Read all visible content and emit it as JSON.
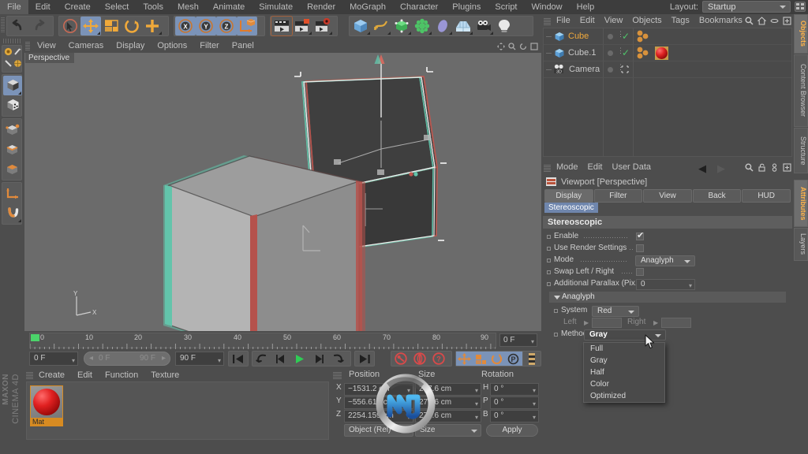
{
  "menubar": {
    "items": [
      "File",
      "Edit",
      "Create",
      "Select",
      "Tools",
      "Mesh",
      "Animate",
      "Simulate",
      "Render",
      "MoGraph",
      "Character",
      "Plugins",
      "Script",
      "Window",
      "Help"
    ],
    "layout_label": "Layout:",
    "layout_value": "Startup"
  },
  "viewport": {
    "menu": [
      "View",
      "Cameras",
      "Display",
      "Options",
      "Filter",
      "Panel"
    ],
    "tag": "Perspective",
    "axis_x": "X",
    "axis_y": "Y"
  },
  "timeline": {
    "ticks": [
      "0",
      "10",
      "20",
      "30",
      "40",
      "50",
      "60",
      "70",
      "80",
      "90"
    ],
    "current_frame_box": "0 F",
    "start_field": "0 F",
    "range_start": "0 F",
    "range_end": "90 F",
    "end_field": "90 F"
  },
  "material_manager": {
    "menu": [
      "Create",
      "Edit",
      "Function",
      "Texture"
    ],
    "materials": [
      {
        "name": "Mat"
      }
    ]
  },
  "coordinates": {
    "columns": [
      "Position",
      "Size",
      "Rotation"
    ],
    "rows": [
      {
        "axis": "X",
        "position": "−1531.2 cm",
        "size": "277.6 cm",
        "rot_axis": "H",
        "rotation": "0 °"
      },
      {
        "axis": "Y",
        "position": "−556.619 cm",
        "size": "277.6 cm",
        "rot_axis": "P",
        "rotation": "0 °"
      },
      {
        "axis": "Z",
        "position": "2254.159 cm",
        "size": "277.6 cm",
        "rot_axis": "B",
        "rotation": "0 °"
      }
    ],
    "object_mode": "Object (Rel)",
    "size_mode": "Size",
    "apply": "Apply"
  },
  "object_manager": {
    "menu": [
      "File",
      "Edit",
      "View",
      "Objects",
      "Tags",
      "Bookmarks"
    ],
    "objects": [
      {
        "name": "Cube",
        "selected": true,
        "type": "cube",
        "has_material": false
      },
      {
        "name": "Cube.1",
        "selected": false,
        "type": "cube",
        "has_material": true
      },
      {
        "name": "Camera",
        "selected": false,
        "type": "camera",
        "has_material": false
      }
    ]
  },
  "attributes": {
    "menu": [
      "Mode",
      "Edit",
      "User Data"
    ],
    "object_title": "Viewport [Perspective]",
    "tabs": [
      "Display",
      "Filter",
      "View",
      "Back",
      "HUD"
    ],
    "active_tab": "Display",
    "subtab": "Stereoscopic",
    "section_title": "Stereoscopic",
    "fields": {
      "enable_label": "Enable",
      "enable_checked": true,
      "use_render_settings_label": "Use Render Settings",
      "use_render_settings_checked": false,
      "mode_label": "Mode",
      "mode_value": "Anaglyph",
      "swap_label": "Swap Left / Right",
      "swap_checked": false,
      "parallax_label": "Additional Parallax (Pix.)",
      "parallax_value": "0"
    },
    "anaglyph": {
      "group_title": "Anaglyph",
      "system_label": "System",
      "system_value": "Red",
      "left_label": "Left",
      "left_value": "",
      "right_label": "Right",
      "right_value": "",
      "method_label": "Method",
      "method_value": "Gray"
    }
  },
  "dropdown": {
    "open": true,
    "options": [
      "Full",
      "Gray",
      "Half",
      "Color",
      "Optimized"
    ],
    "selected": "Gray"
  },
  "right_tabs": [
    {
      "label": "Objects",
      "active": true
    },
    {
      "label": "Content Browser",
      "active": false
    },
    {
      "label": "Structure",
      "active": false
    },
    {
      "label": "Attributes",
      "active": true
    },
    {
      "label": "Layers",
      "active": false
    }
  ],
  "brand": {
    "maxon": "MAXON",
    "product": "CINEMA 4D"
  },
  "colors": {
    "accent_blue": "#7b93b8",
    "highlight_orange": "#ffb44a",
    "selection_blue": "#6f86ad",
    "panel_bg": "#4d4d4d",
    "viewport_bg": "#6b6b6b",
    "anaglyph_red": "#b55b5b",
    "anaglyph_cyan": "#6fc9ae",
    "green_marker": "#4bd46a"
  }
}
